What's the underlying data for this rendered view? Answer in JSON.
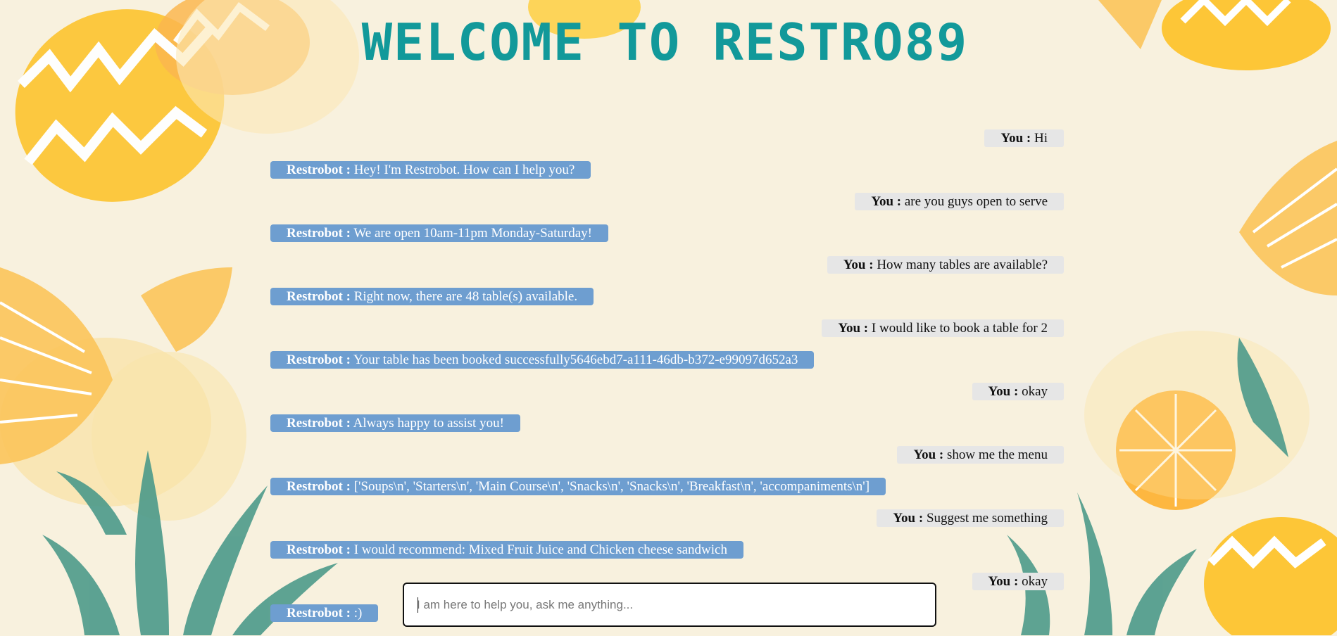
{
  "page": {
    "title": "WELCOME TO RESTRO89"
  },
  "colors": {
    "title": "#12999a",
    "bot_bubble": "#6e9ed0",
    "user_bubble": "#e6e6e6",
    "background": "#f8f1de"
  },
  "decor": {
    "background_art": "pineapple-pattern-illustration"
  },
  "chat": {
    "messages": [
      {
        "sender": "You :",
        "text": "Hi",
        "role": "user"
      },
      {
        "sender": "Restrobot :",
        "text": "Hey! I'm Restrobot. How can I help you?",
        "role": "bot"
      },
      {
        "sender": "You :",
        "text": "are you guys open to serve",
        "role": "user"
      },
      {
        "sender": "Restrobot :",
        "text": "We are open 10am-11pm Monday-Saturday!",
        "role": "bot"
      },
      {
        "sender": "You :",
        "text": "How many tables are available?",
        "role": "user"
      },
      {
        "sender": "Restrobot :",
        "text": "Right now, there are 48 table(s) available.",
        "role": "bot"
      },
      {
        "sender": "You :",
        "text": "I would like to book a table for 2",
        "role": "user"
      },
      {
        "sender": "Restrobot :",
        "text": "Your table has been booked successfully5646ebd7-a111-46db-b372-e99097d652a3",
        "role": "bot"
      },
      {
        "sender": "You :",
        "text": "okay",
        "role": "user"
      },
      {
        "sender": "Restrobot :",
        "text": "Always happy to assist you!",
        "role": "bot"
      },
      {
        "sender": "You :",
        "text": "show me the menu",
        "role": "user"
      },
      {
        "sender": "Restrobot :",
        "text": "['Soups\\n', 'Starters\\n', 'Main Course\\n', 'Snacks\\n', 'Snacks\\n', 'Breakfast\\n', 'accompaniments\\n']",
        "role": "bot"
      },
      {
        "sender": "You :",
        "text": "Suggest me something",
        "role": "user"
      },
      {
        "sender": "Restrobot :",
        "text": "I would recommend: Mixed Fruit Juice and Chicken cheese sandwich",
        "role": "bot"
      },
      {
        "sender": "You :",
        "text": "okay",
        "role": "user"
      },
      {
        "sender": "Restrobot :",
        "text": ":)",
        "role": "bot"
      }
    ]
  },
  "input": {
    "value": "",
    "placeholder": "I am here to help you, ask me anything..."
  }
}
